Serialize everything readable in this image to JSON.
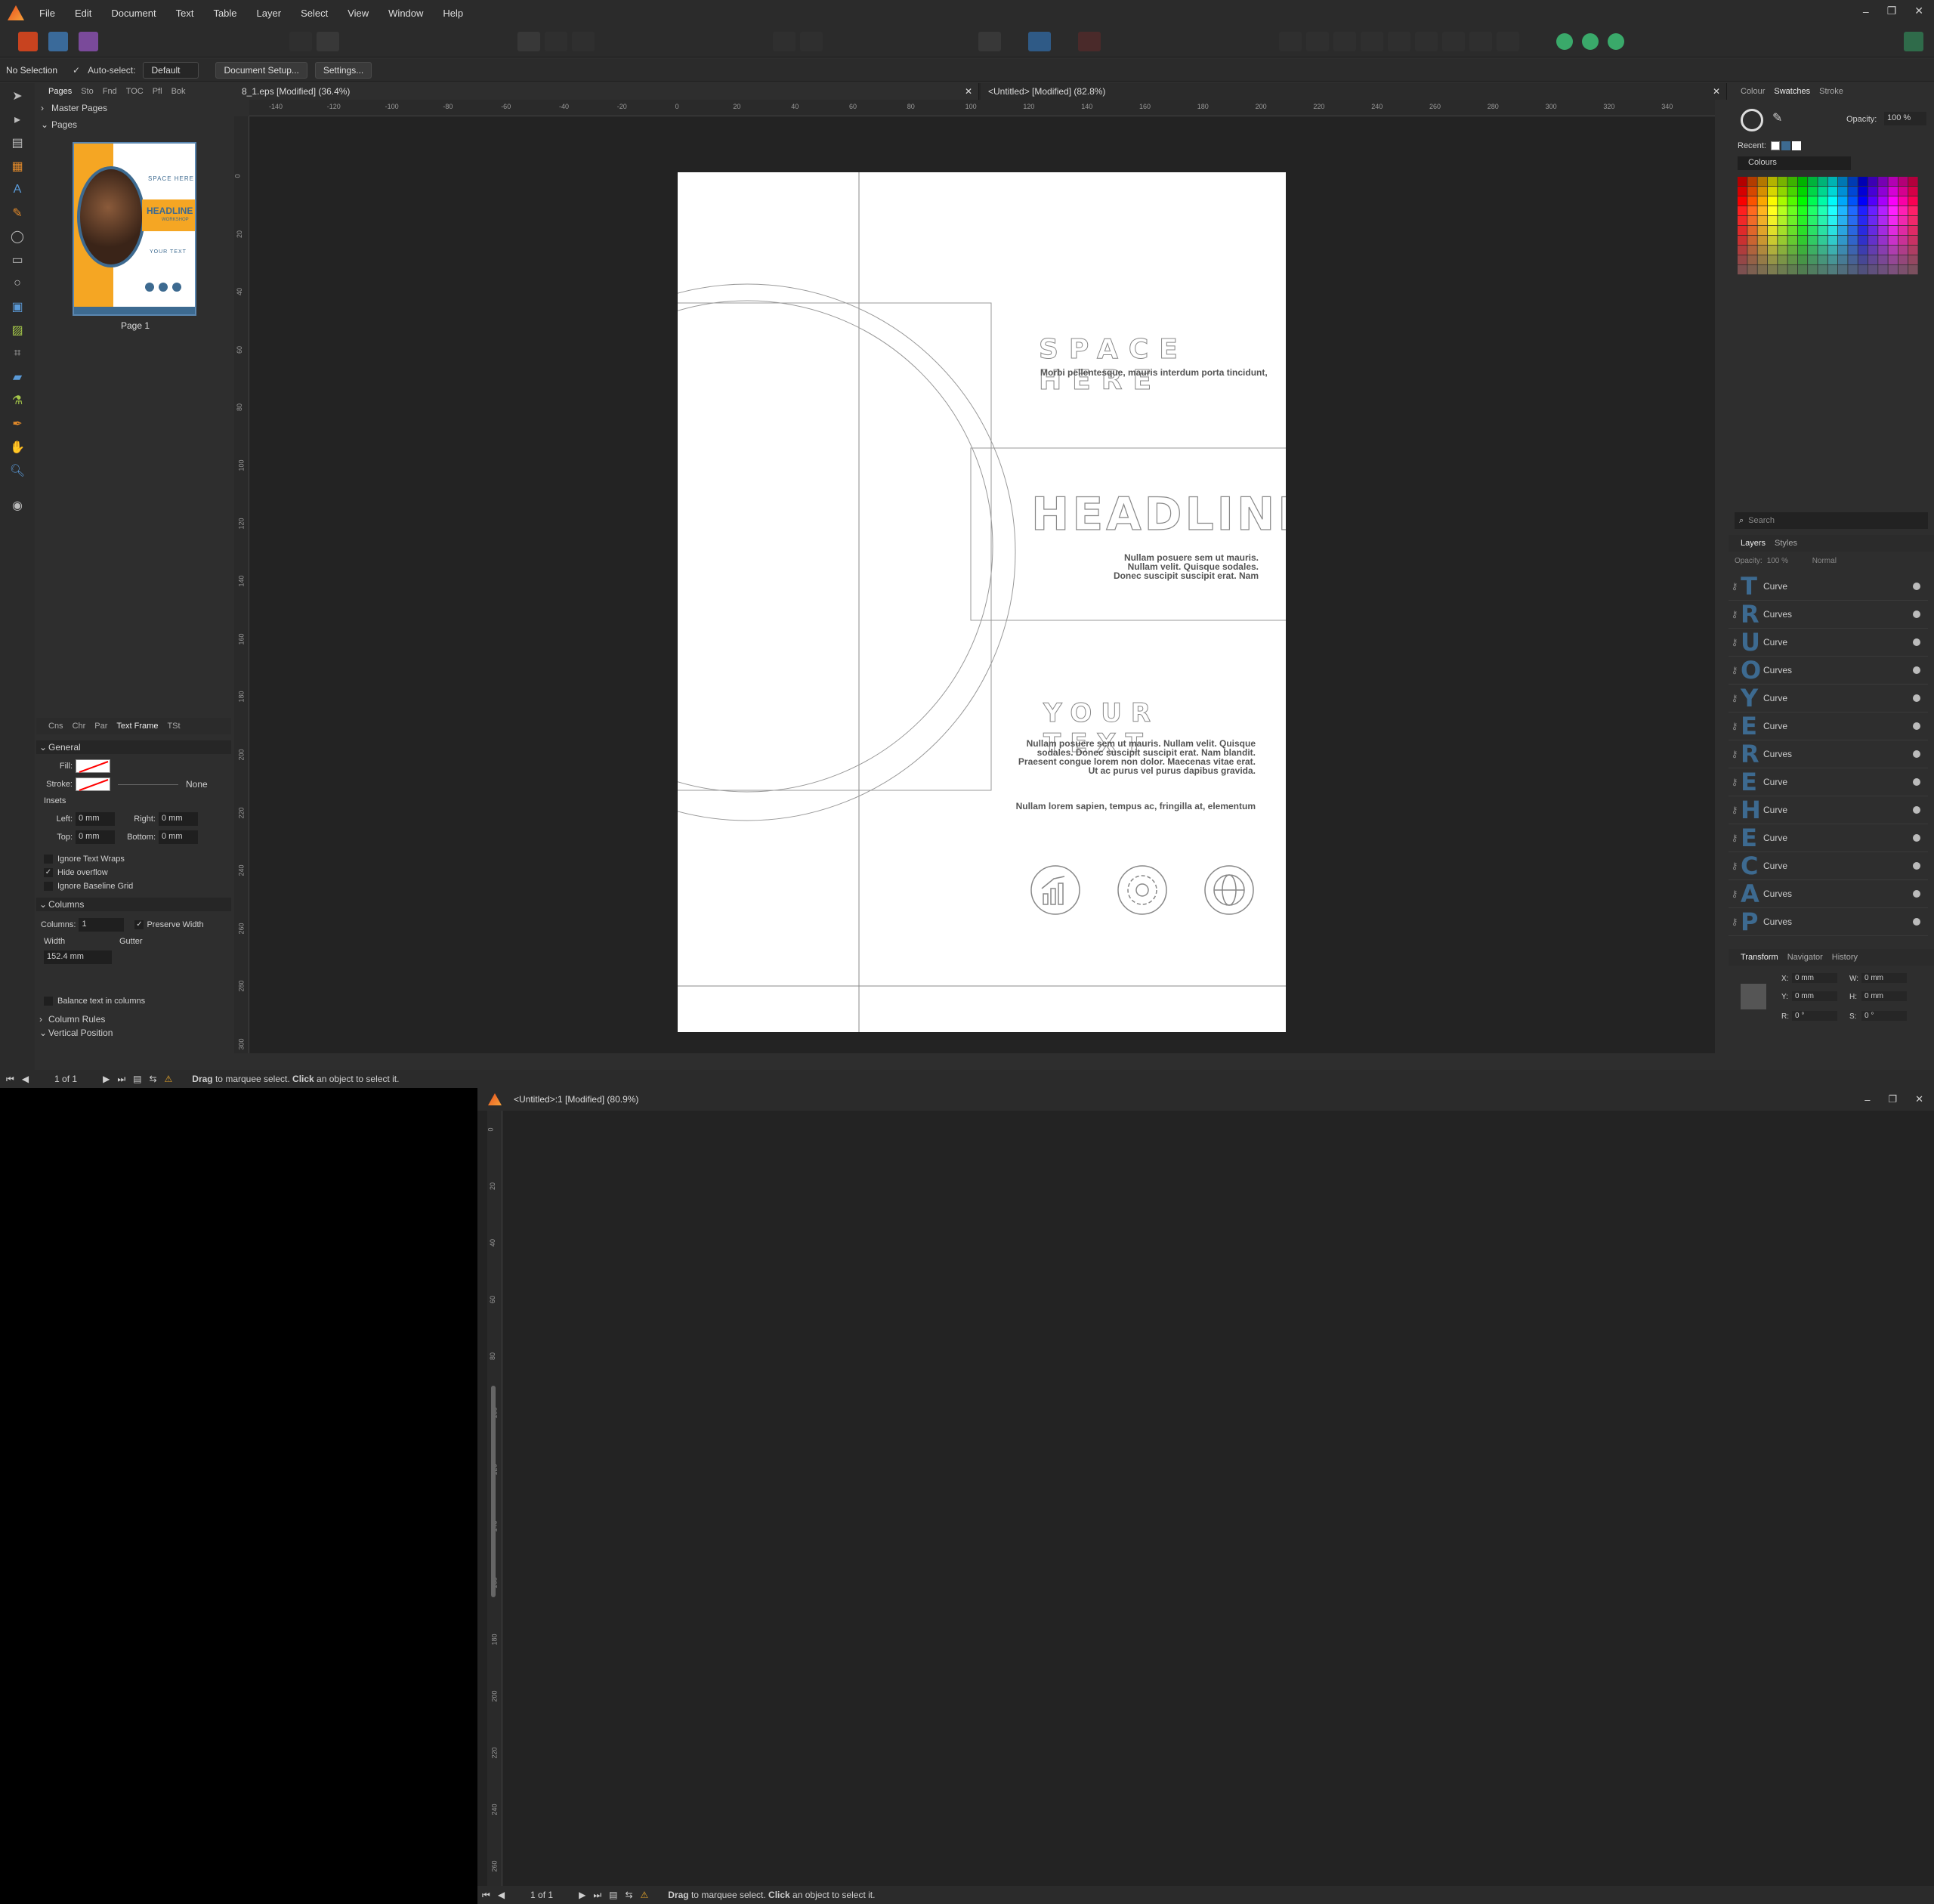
{
  "menu": [
    "File",
    "Edit",
    "Document",
    "Text",
    "Table",
    "Layer",
    "Select",
    "View",
    "Window",
    "Help"
  ],
  "context": {
    "selection": "No Selection",
    "autoselect": "Auto-select:",
    "autoselect_value": "Default",
    "doc_setup": "Document Setup...",
    "settings": "Settings..."
  },
  "left_tabs": [
    "Pages",
    "Sto",
    "Fnd",
    "TOC",
    "Pfl",
    "Bok"
  ],
  "pages_panel": {
    "master": "Master Pages",
    "pages": "Pages",
    "page_label": "Page 1"
  },
  "thumb": {
    "space": "SPACE HERE",
    "headline": "HEADLINE",
    "sub": "WORKSHOP",
    "your": "YOUR TEXT"
  },
  "frame_tabs": [
    "Cns",
    "Chr",
    "Par",
    "Text Frame",
    "TSt"
  ],
  "text_frame": {
    "general": "General",
    "fill": "Fill:",
    "stroke": "Stroke:",
    "stroke_value": "None",
    "insets": "Insets",
    "left": "Left:",
    "right": "Right:",
    "top": "Top:",
    "bottom": "Bottom:",
    "inset_val": "0 mm",
    "ignore_wraps": "Ignore Text Wraps",
    "hide_overflow": "Hide overflow",
    "ignore_baseline": "Ignore Baseline Grid",
    "columns": "Columns",
    "columns_label": "Columns:",
    "columns_val": "1",
    "preserve": "Preserve Width",
    "width": "Width",
    "gutter": "Gutter",
    "width_val": "152.4 mm",
    "balance": "Balance text in columns",
    "column_rules": "Column Rules",
    "vertical_position": "Vertical Position"
  },
  "doc_tabs": {
    "tab1": "8_1.eps [Modified] (36.4%)",
    "tab2": "<Untitled> [Modified] (82.8%)"
  },
  "ruler_top": [
    "-140",
    "-120",
    "-100",
    "-80",
    "-60",
    "-40",
    "-20",
    "0",
    "20",
    "40",
    "60",
    "80",
    "100",
    "120",
    "140",
    "160",
    "180",
    "200",
    "220",
    "240",
    "260",
    "280",
    "300",
    "320",
    "340"
  ],
  "ruler_left": [
    "0",
    "20",
    "40",
    "60",
    "80",
    "100",
    "120",
    "140",
    "160",
    "180",
    "200",
    "220",
    "240",
    "260",
    "280",
    "300"
  ],
  "design": {
    "space_here": "SPACE HERE",
    "space_sub": "Morbi pellentesque, mauris interdum porta tincidunt,",
    "headline": "HEADLINE",
    "head_body1": "Nullam posuere sem ut mauris.",
    "head_body2": "Nullam velit. Quisque sodales.",
    "head_body3": "Donec suscipit suscipit erat. Nam",
    "your_text": "YOUR TEXT",
    "your_body1": "Nullam posuere sem ut mauris. Nullam velit. Quisque",
    "your_body2": "sodales. Donec suscipit suscipit erat. Nam blandit.",
    "your_body3": "Praesent congue lorem non dolor. Maecenas vitae erat.",
    "your_body4": "Ut ac purus vel purus dapibus gravida.",
    "your_footer": "Nullam lorem sapien, tempus ac, fringilla at, elementum"
  },
  "right_tabs": [
    "Colour",
    "Swatches",
    "Stroke"
  ],
  "swatches": {
    "opacity": "Opacity:",
    "opacity_val": "100 %",
    "recent": "Recent:",
    "palette": "Colours"
  },
  "search": "Search",
  "layers_tabs": [
    "Layers",
    "Styles"
  ],
  "layers_ctrl": {
    "opacity": "Opacity:",
    "opacity_val": "100 %",
    "blend": "Normal"
  },
  "layers": [
    {
      "glyph": "T",
      "name": "Curve"
    },
    {
      "glyph": "R",
      "name": "Curves"
    },
    {
      "glyph": "U",
      "name": "Curve"
    },
    {
      "glyph": "O",
      "name": "Curves"
    },
    {
      "glyph": "Y",
      "name": "Curve"
    },
    {
      "glyph": "E",
      "name": "Curve"
    },
    {
      "glyph": "R",
      "name": "Curves"
    },
    {
      "glyph": "E",
      "name": "Curve"
    },
    {
      "glyph": "H",
      "name": "Curve"
    },
    {
      "glyph": "E",
      "name": "Curve"
    },
    {
      "glyph": "C",
      "name": "Curve"
    },
    {
      "glyph": "A",
      "name": "Curves"
    },
    {
      "glyph": "P",
      "name": "Curves"
    }
  ],
  "transform_tabs": [
    "Transform",
    "Navigator",
    "History"
  ],
  "transform": {
    "x": "X:",
    "y": "Y:",
    "w": "W:",
    "h": "H:",
    "r": "R:",
    "s": "S:",
    "mm": "0 mm",
    "deg": "0 °"
  },
  "status": {
    "pages": "1 of 1",
    "drag": "Drag",
    "mid": " to marquee select. ",
    "click": "Click",
    "end": " an object to select it."
  },
  "win2": {
    "title": "<Untitled>:1 [Modified] (80.9%)",
    "pages": "1 of 1"
  },
  "win2_ruler": [
    "0",
    "20",
    "40",
    "60",
    "80",
    "100",
    "120",
    "140",
    "160",
    "180",
    "200",
    "220",
    "240",
    "260"
  ],
  "colors": {
    "accent": "#f5a623",
    "brand": "#3d6a90",
    "bg": "#2e2e2e"
  }
}
